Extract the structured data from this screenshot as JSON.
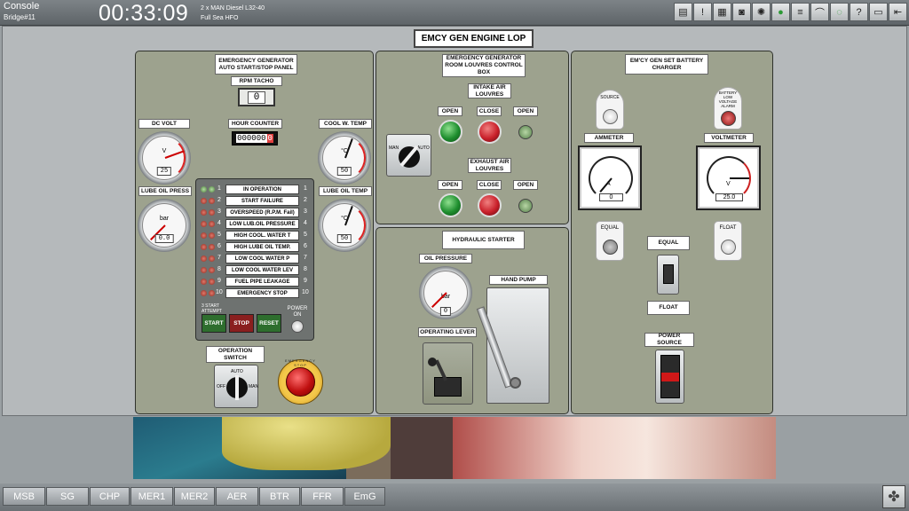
{
  "topbar": {
    "title": "Console",
    "subtitle": "Bridge#11",
    "clock": "00:33:09",
    "engine_line1": "2 x MAN Diesel L32-40",
    "engine_line2": "Full Sea HFO",
    "tools": [
      "menu-icon",
      "alarm-list-icon",
      "print-icon",
      "camera-icon",
      "fan-icon",
      "green-indicator-icon",
      "sheet-icon",
      "chart-icon",
      "chat-icon",
      "help-icon",
      "printer-icon",
      "exit-icon"
    ]
  },
  "page_title": "EMCY GEN ENGINE LOP",
  "left_panel": {
    "title": "EMERGENCY GENERATOR AUTO START/STOP PANEL",
    "rpm_label": "RPM TACHO",
    "rpm_value": "0",
    "dc_volt_label": "DC VOLT",
    "dc_volt_unit": "V",
    "dc_volt_value": "25",
    "hour_counter_label": "HOUR COUNTER",
    "hour_counter_value": "000000",
    "hour_counter_last": "0",
    "cool_temp_label": "COOL W. TEMP",
    "cool_temp_unit": "°C",
    "cool_temp_value": "50",
    "lube_press_label": "LUBE OIL PRESS",
    "lube_press_unit": "bar",
    "lube_press_value": "0.0",
    "lube_temp_label": "LUBE OIL TEMP",
    "lube_temp_unit": "°C",
    "lube_temp_value": "50",
    "alarms": [
      {
        "num": "1",
        "text": "IN OPERATION"
      },
      {
        "num": "2",
        "text": "START FAILURE"
      },
      {
        "num": "3",
        "text": "OVERSPEED (R.P.M. Fail)"
      },
      {
        "num": "4",
        "text": "LOW LUB.OIL PRESSURE"
      },
      {
        "num": "5",
        "text": "HIGH COOL. WATER T"
      },
      {
        "num": "6",
        "text": "HIGH LUBE OIL TEMP."
      },
      {
        "num": "7",
        "text": "LOW COOL WATER P"
      },
      {
        "num": "8",
        "text": "LOW COOL WATER LEV"
      },
      {
        "num": "9",
        "text": "FUEL PIPE LEAKAGE"
      },
      {
        "num": "10",
        "text": "EMERGENCY STOP"
      }
    ],
    "start_attempt": "3 START ATTEMPT",
    "start_label": "START",
    "stop_label": "STOP",
    "reset_label": "RESET",
    "power_on_label": "POWER ON",
    "op_switch_label": "OPERATION SWITCH",
    "op_auto": "AUTO",
    "op_off": "OFF",
    "op_man": "MAN",
    "emergency_label": "EMERGENCY STOP"
  },
  "louvres_panel": {
    "title": "EMERGENCY GENERATOR ROOM LOUVRES CONTROL BOX",
    "intake_label": "INTAKE AIR LOUVRES",
    "exhaust_label": "EXHAUST AIR LOUVRES",
    "open_label": "OPEN",
    "close_label": "CLOSE",
    "man_label": "MAN",
    "auto_label": "AUTO"
  },
  "hydraulic_panel": {
    "title": "HYDRAULIC STARTER",
    "oil_pressure_label": "OIL PRESSURE",
    "oil_pressure_unit": "bar",
    "oil_pressure_value": "0",
    "hand_pump_label": "HAND PUMP",
    "operating_lever_label": "OPERATING LEVER"
  },
  "charger_panel": {
    "title": "EM'CY GEN SET BATTERY CHARGER",
    "source_label": "SOURCE",
    "battery_alarm_label": "BATTERY LOW VOLTAGE ALARM",
    "ammeter_label": "AMMETER",
    "ammeter_unit": "A",
    "ammeter_value": "0",
    "voltmeter_label": "VOLTMETER",
    "voltmeter_unit": "V",
    "voltmeter_value": "25.0",
    "equal_label": "EQUAL",
    "float_label": "FLOAT",
    "equal_switch_label": "EQUAL",
    "float_switch_label": "FLOAT",
    "power_source_label": "POWER SOURCE"
  },
  "tabs": [
    "MSB",
    "SG",
    "CHP",
    "MER1",
    "MER2",
    "AER",
    "BTR",
    "FFR",
    "EmG"
  ],
  "active_tab": "EmG",
  "colors": {
    "panel": "#9da28e",
    "lamp_red": "#c9202a",
    "lamp_green": "#1e8e2e"
  }
}
